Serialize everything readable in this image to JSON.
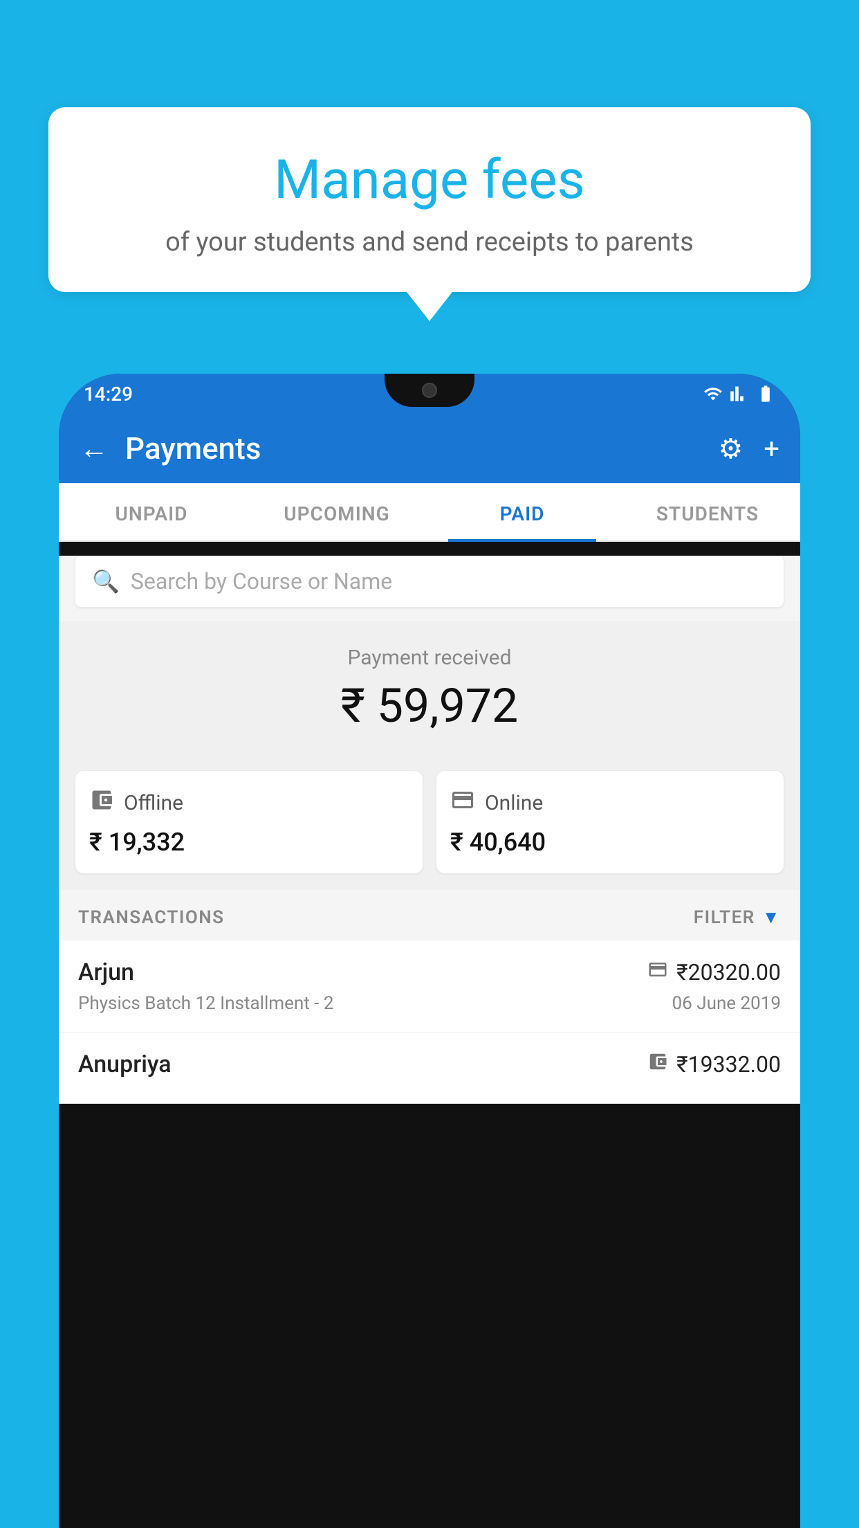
{
  "page": {
    "background_color": "#1ab3e8"
  },
  "bubble": {
    "title": "Manage fees",
    "subtitle": "of your students and send receipts to parents"
  },
  "status_bar": {
    "time": "14:29"
  },
  "header": {
    "title": "Payments",
    "back_label": "←",
    "settings_label": "⚙",
    "add_label": "+"
  },
  "tabs": [
    {
      "label": "UNPAID",
      "active": false
    },
    {
      "label": "UPCOMING",
      "active": false
    },
    {
      "label": "PAID",
      "active": true
    },
    {
      "label": "STUDENTS",
      "active": false
    }
  ],
  "search": {
    "placeholder": "Search by Course or Name"
  },
  "payment_received": {
    "label": "Payment received",
    "amount": "₹ 59,972"
  },
  "payment_cards": [
    {
      "type": "Offline",
      "amount": "₹ 19,332",
      "icon": "offline"
    },
    {
      "type": "Online",
      "amount": "₹ 40,640",
      "icon": "online"
    }
  ],
  "transactions_section": {
    "label": "TRANSACTIONS",
    "filter_label": "FILTER"
  },
  "transactions": [
    {
      "name": "Arjun",
      "course": "Physics Batch 12 Installment - 2",
      "amount": "₹20320.00",
      "date": "06 June 2019",
      "icon": "online"
    },
    {
      "name": "Anupriya",
      "course": "",
      "amount": "₹19332.00",
      "date": "",
      "icon": "offline"
    }
  ]
}
